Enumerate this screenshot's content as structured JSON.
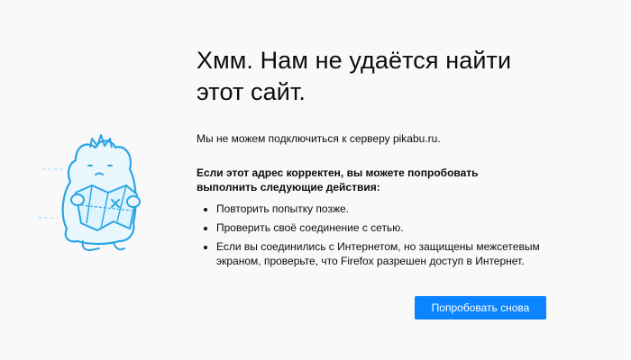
{
  "error": {
    "title": "Хмм. Нам не удаётся найти этот сайт.",
    "message": "Мы не можем подключиться к серверу pikabu.ru.",
    "advice_heading": "Если этот адрес корректен, вы можете попробовать выполнить следующие действия:",
    "advice_items": [
      "Повторить попытку позже.",
      "Проверить своё соединение с сетью.",
      "Если вы соединились с Интернетом, но защищены межсетевым экраном, проверьте, что Firefox разрешен доступ в Интернет."
    ],
    "retry_label": "Попробовать снова"
  },
  "colors": {
    "background": "#f9f9fa",
    "button": "#0a84ff",
    "illustration_stroke": "#2aa5e6",
    "illustration_fill": "#ddf3fd"
  }
}
